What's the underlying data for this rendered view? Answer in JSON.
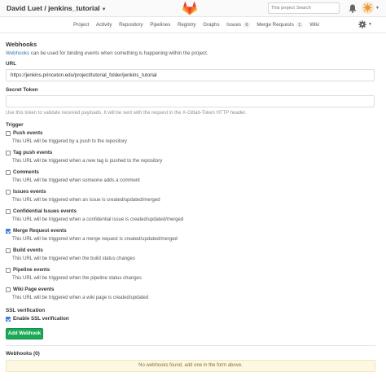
{
  "header": {
    "title": "David Luet / jenkins_tutorial",
    "search_scope": "This project",
    "search_placeholder": "Search"
  },
  "nav": {
    "tabs": [
      {
        "label": "Project"
      },
      {
        "label": "Activity"
      },
      {
        "label": "Repository"
      },
      {
        "label": "Pipelines"
      },
      {
        "label": "Registry"
      },
      {
        "label": "Graphs"
      },
      {
        "label": "Issues",
        "count": "0"
      },
      {
        "label": "Merge Requests",
        "count": "1"
      },
      {
        "label": "Wiki"
      }
    ]
  },
  "webhooks": {
    "title": "Webhooks",
    "intro_link": "Webhooks",
    "intro_text": " can be used for binding events when something is happening within the project.",
    "url_label": "URL",
    "url_value": "https://jenkins.princeton.edu/project/tutorial_folder/jenkins_tutorial",
    "token_label": "Secret Token",
    "token_value": "",
    "token_help": "Use this token to validate received payloads. It will be sent with the request in the X-Gitlab-Token HTTP header.",
    "trigger_label": "Trigger",
    "triggers": [
      {
        "label": "Push events",
        "desc": "This URL will be triggered by a push to the repository",
        "checked": false
      },
      {
        "label": "Tag push events",
        "desc": "This URL will be triggered when a new tag is pushed to the repository",
        "checked": false
      },
      {
        "label": "Comments",
        "desc": "This URL will be triggered when someone adds a comment",
        "checked": false
      },
      {
        "label": "Issues events",
        "desc": "This URL will be triggered when an issue is created/updated/merged",
        "checked": false
      },
      {
        "label": "Confidential Issues events",
        "desc": "This URL will be triggered when a confidential issue is created/updated/merged",
        "checked": false
      },
      {
        "label": "Merge Request events",
        "desc": "This URL will be triggered when a merge request is created/updated/merged",
        "checked": true
      },
      {
        "label": "Build events",
        "desc": "This URL will be triggered when the build status changes",
        "checked": false
      },
      {
        "label": "Pipeline events",
        "desc": "This URL will be triggered when the pipeline status changes",
        "checked": false
      },
      {
        "label": "Wiki Page events",
        "desc": "This URL will be triggered when a wiki page is created/updated",
        "checked": false
      }
    ],
    "ssl_label": "SSL verification",
    "ssl_option": "Enable SSL verification",
    "ssl_checked": true,
    "add_button": "Add Webhook",
    "list_title": "Webhooks (0)",
    "empty_message": "No webhooks found, add one in the form above."
  },
  "colors": {
    "accent": "#3777b0",
    "success": "#1aaa55",
    "warning_bg": "#fcf8e3"
  },
  "icons": {
    "logo": "gitlab-tanuki-icon",
    "notifications": "bell-icon",
    "settings": "gear-icon"
  }
}
